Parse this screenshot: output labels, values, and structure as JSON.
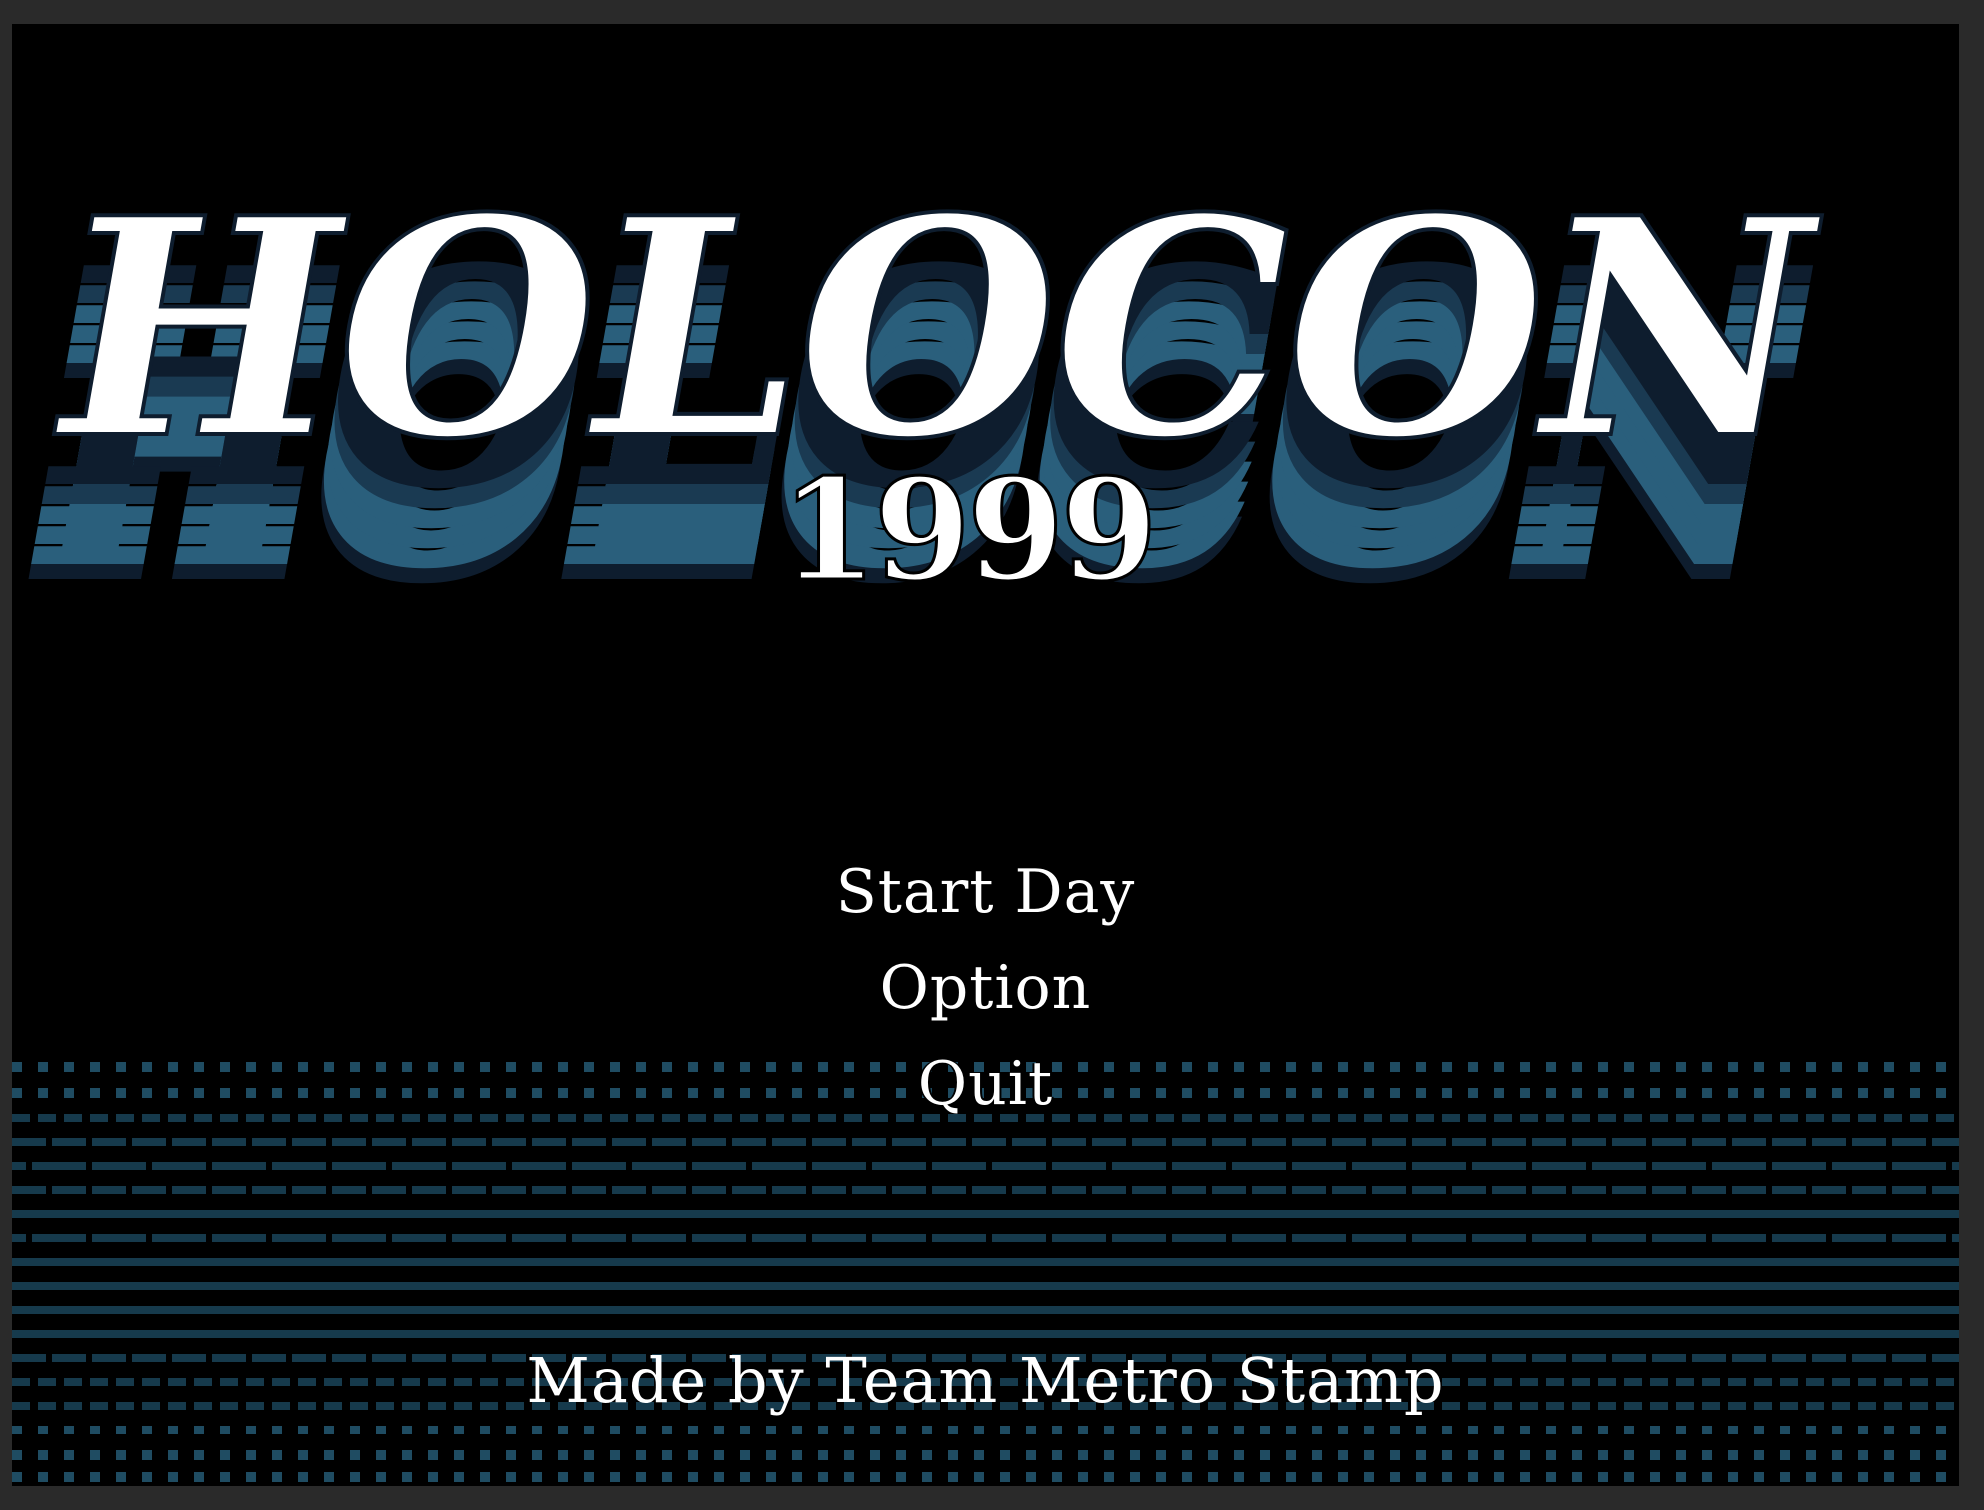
{
  "game": {
    "title": "HOLOCON",
    "year": "1999"
  },
  "menu": {
    "items": [
      {
        "label": "Start Day"
      },
      {
        "label": "Option"
      },
      {
        "label": "Quit"
      }
    ]
  },
  "credits": "Made by Team Metro Stamp",
  "colors": {
    "background": "#000000",
    "frame": "#2a2a2a",
    "logo_face": "#ffffff",
    "logo_extrude_light": "#2a5f7c",
    "logo_extrude_dark": "#0e1d2e",
    "ground_lines": "#163a4c",
    "ground_dots": "#1f4c62",
    "text": "#ffffff"
  }
}
